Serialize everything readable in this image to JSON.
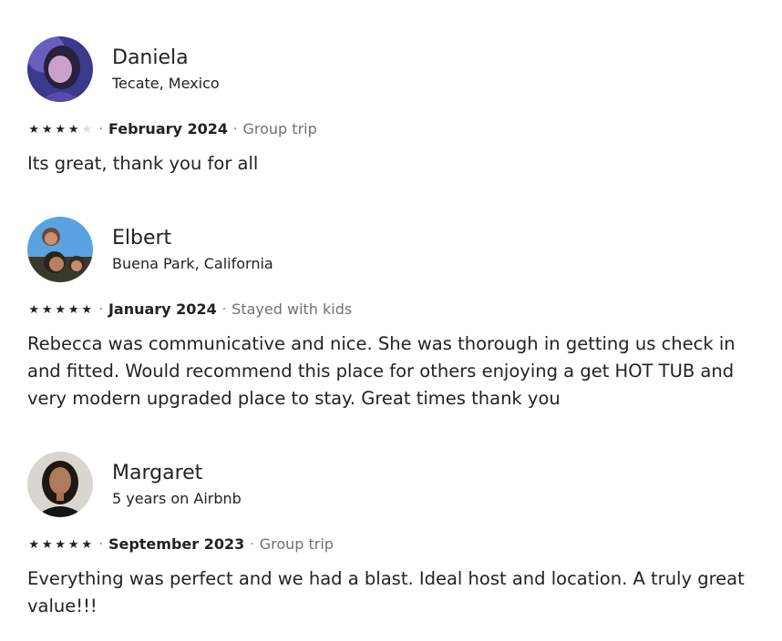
{
  "reviews": [
    {
      "name": "Daniela",
      "location": "Tecate, Mexico",
      "rating": 4,
      "star_glyph": "★",
      "separator": "·",
      "date": "February 2024",
      "trip_type": "Group trip",
      "text": "Its great, thank you for all"
    },
    {
      "name": "Elbert",
      "location": "Buena Park, California",
      "rating": 5,
      "star_glyph": "★",
      "separator": "·",
      "date": "January 2024",
      "trip_type": "Stayed with kids",
      "text": "Rebecca was communicative and nice. She was thorough in getting us check in and fitted. Would recommend this place for others enjoying a get HOT TUB and very modern upgraded place to stay. Great times thank you"
    },
    {
      "name": "Margaret",
      "location": "5 years on Airbnb",
      "rating": 5,
      "star_glyph": "★",
      "separator": "·",
      "date": "September 2023",
      "trip_type": "Group trip",
      "text": "Everything was perfect and we had a blast. Ideal host and location. A truly great value!!!"
    }
  ],
  "colors": {
    "text": "#222222",
    "muted": "#717171",
    "star_filled": "#222222",
    "star_empty": "#dddddd"
  }
}
